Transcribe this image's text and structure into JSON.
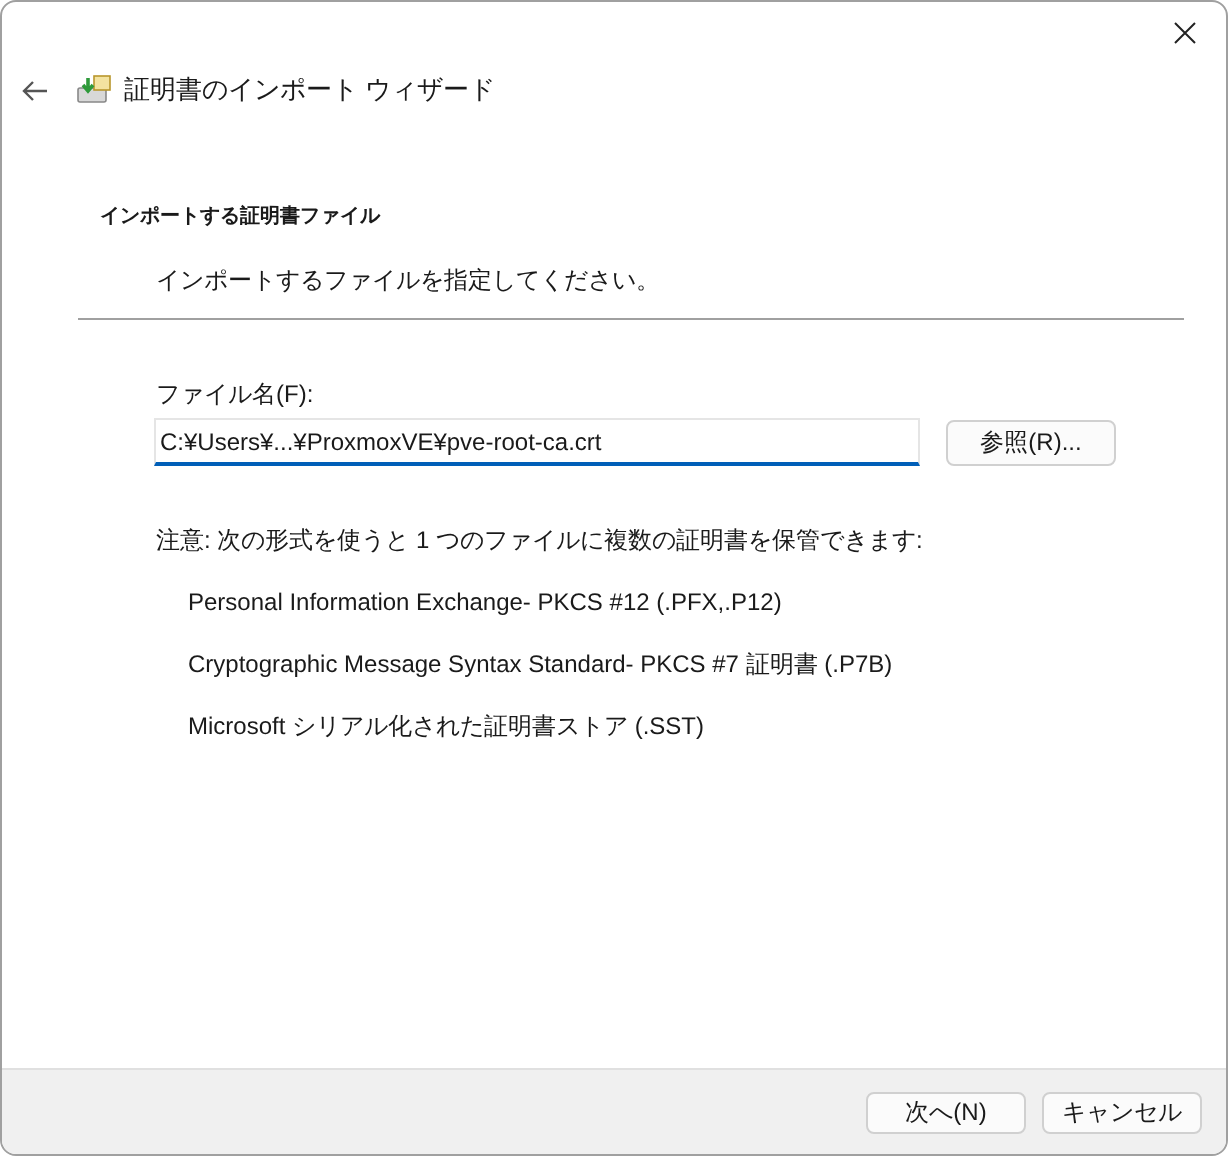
{
  "window": {
    "title": "証明書のインポート ウィザード"
  },
  "page": {
    "heading": "インポートする証明書ファイル",
    "subtitle": "インポートするファイルを指定してください。"
  },
  "file_field": {
    "label": "ファイル名(F):",
    "value": "C:¥Users¥...¥ProxmoxVE¥pve-root-ca.crt",
    "browse_button": "参照(R)..."
  },
  "note": "注意: 次の形式を使うと 1 つのファイルに複数の証明書を保管できます:",
  "formats": [
    "Personal Information Exchange- PKCS #12 (.PFX,.P12)",
    "Cryptographic Message Syntax Standard- PKCS #7 証明書 (.P7B)",
    "Microsoft シリアル化された証明書ストア (.SST)"
  ],
  "buttons": [
    "次へ(N)",
    "キャンセル"
  ]
}
